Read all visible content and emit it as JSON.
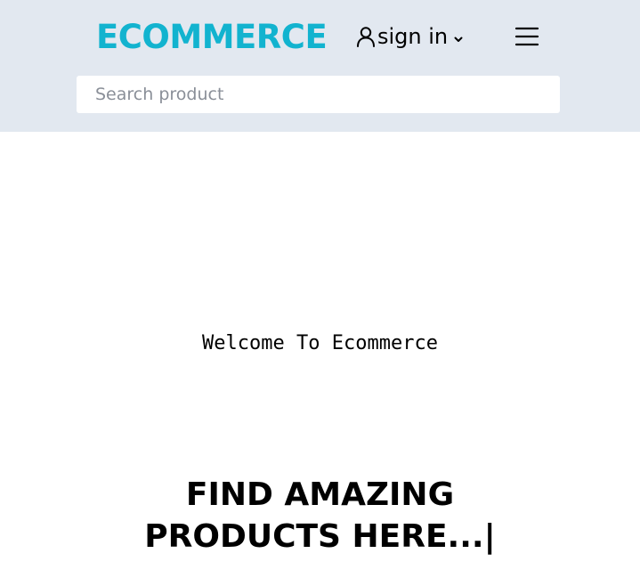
{
  "header": {
    "brand": "ECOMMERCE",
    "signin_label": "sign in",
    "user_icon": "user-icon",
    "chevron_icon": "chevron-down-icon",
    "menu_icon": "hamburger-menu-icon",
    "search_placeholder": "Search product",
    "background_color": "#e2e8f0",
    "brand_color": "#12b3cf"
  },
  "main": {
    "welcome": "Welcome To Ecommerce",
    "tagline_line1": "FIND AMAZING",
    "tagline_line2": "PRODUCTS HERE...|"
  }
}
